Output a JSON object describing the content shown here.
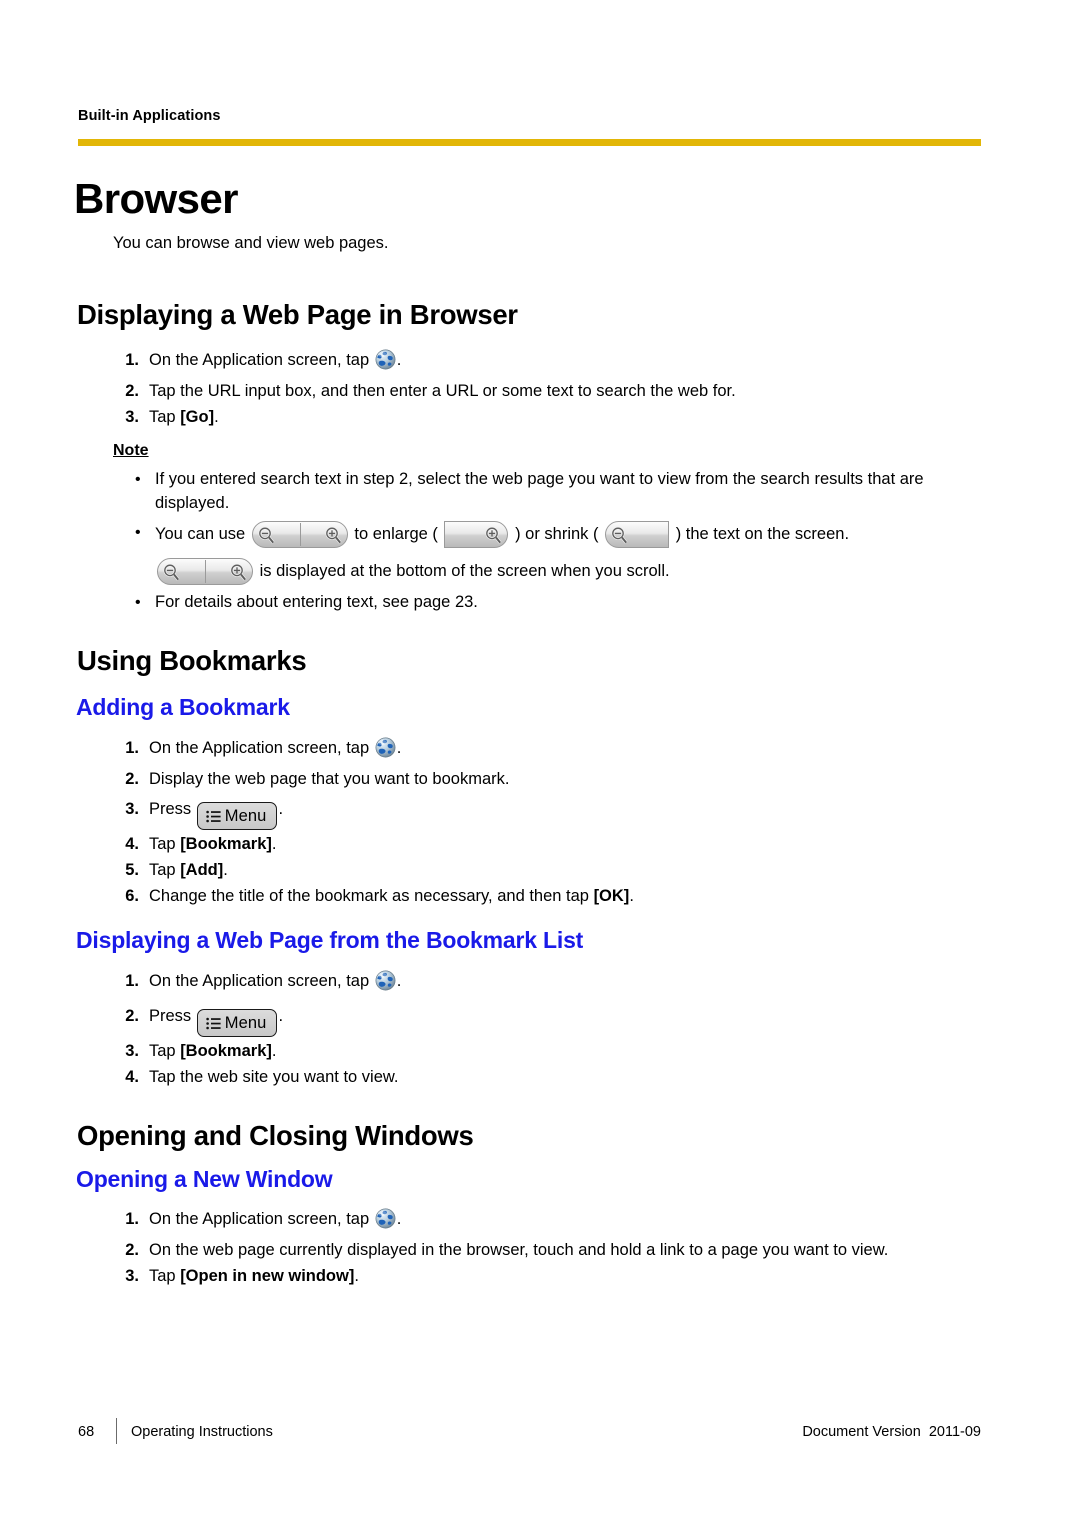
{
  "header": {
    "running_title": "Built-in Applications",
    "rule_color": "#e2b607"
  },
  "chapter": {
    "title": "Browser",
    "intro": "You can browse and view web pages."
  },
  "colors": {
    "heading_blue": "#1a1ae8",
    "rule_yellow": "#e2b607"
  },
  "icons": {
    "globe": "globe-icon",
    "menu_list": "list-icon",
    "zoom_in": "magnifier-plus-icon",
    "zoom_out": "magnifier-minus-icon"
  },
  "sections": {
    "displaying_web_page": {
      "heading": "Displaying a Web Page in Browser",
      "steps": [
        {
          "num": "1.",
          "pre": "On the Application screen, tap ",
          "icon": "globe",
          "post": "."
        },
        {
          "num": "2.",
          "pre": "Tap the URL input box, and then enter a URL or some text to search the web for.",
          "post": ""
        },
        {
          "num": "3.",
          "pre": "Tap ",
          "kw": "[Go]",
          "post": "."
        }
      ],
      "note": {
        "label": "Note",
        "bullet_glyph": "•",
        "items": [
          "If you entered search text in step 2, select the web page you want to view from the search results that are displayed.",
          "For details about entering text, see page 23."
        ],
        "zoom_line": {
          "part1": "You can use",
          "part2": "to enlarge (",
          "part3": ") or shrink (",
          "part4": ") the text on the screen."
        },
        "scroll_line": "is displayed at the bottom of the screen when you scroll."
      }
    },
    "using_bookmarks": {
      "heading": "Using Bookmarks",
      "adding": {
        "heading": "Adding a Bookmark",
        "steps": [
          {
            "num": "1.",
            "pre": "On the Application screen, tap ",
            "icon": "globe",
            "post": "."
          },
          {
            "num": "2.",
            "pre": "Display the web page that you want to bookmark.",
            "post": ""
          },
          {
            "num": "3.",
            "pre": "Press ",
            "menukey": "Menu",
            "post": "."
          },
          {
            "num": "4.",
            "pre": "Tap ",
            "kw": "[Bookmark]",
            "post": "."
          },
          {
            "num": "5.",
            "pre": "Tap ",
            "kw": "[Add]",
            "post": "."
          },
          {
            "num": "6.",
            "pre": "Change the title of the bookmark as necessary, and then tap ",
            "kw": "[OK]",
            "post": "."
          }
        ]
      },
      "from_list": {
        "heading": "Displaying a Web Page from the Bookmark List",
        "steps": [
          {
            "num": "1.",
            "pre": "On the Application screen, tap ",
            "icon": "globe",
            "post": "."
          },
          {
            "num": "2.",
            "pre": "Press ",
            "menukey": "Menu",
            "post": "."
          },
          {
            "num": "3.",
            "pre": "Tap ",
            "kw": "[Bookmark]",
            "post": "."
          },
          {
            "num": "4.",
            "pre": "Tap the web site you want to view.",
            "post": ""
          }
        ]
      }
    },
    "opening_closing": {
      "heading": "Opening and Closing Windows",
      "new_window": {
        "heading": "Opening a New Window",
        "steps": [
          {
            "num": "1.",
            "pre": "On the Application screen, tap ",
            "icon": "globe",
            "post": "."
          },
          {
            "num": "2.",
            "pre": "On the web page currently displayed in the browser, touch and hold a link to a page you want to view.",
            "post": ""
          },
          {
            "num": "3.",
            "pre": "Tap ",
            "kw": "[Open in new window]",
            "post": "."
          }
        ]
      }
    }
  },
  "footer": {
    "page_number": "68",
    "doc_title": "Operating Instructions",
    "version": "Document Version  2011-09"
  },
  "menu_key_label": "Menu"
}
